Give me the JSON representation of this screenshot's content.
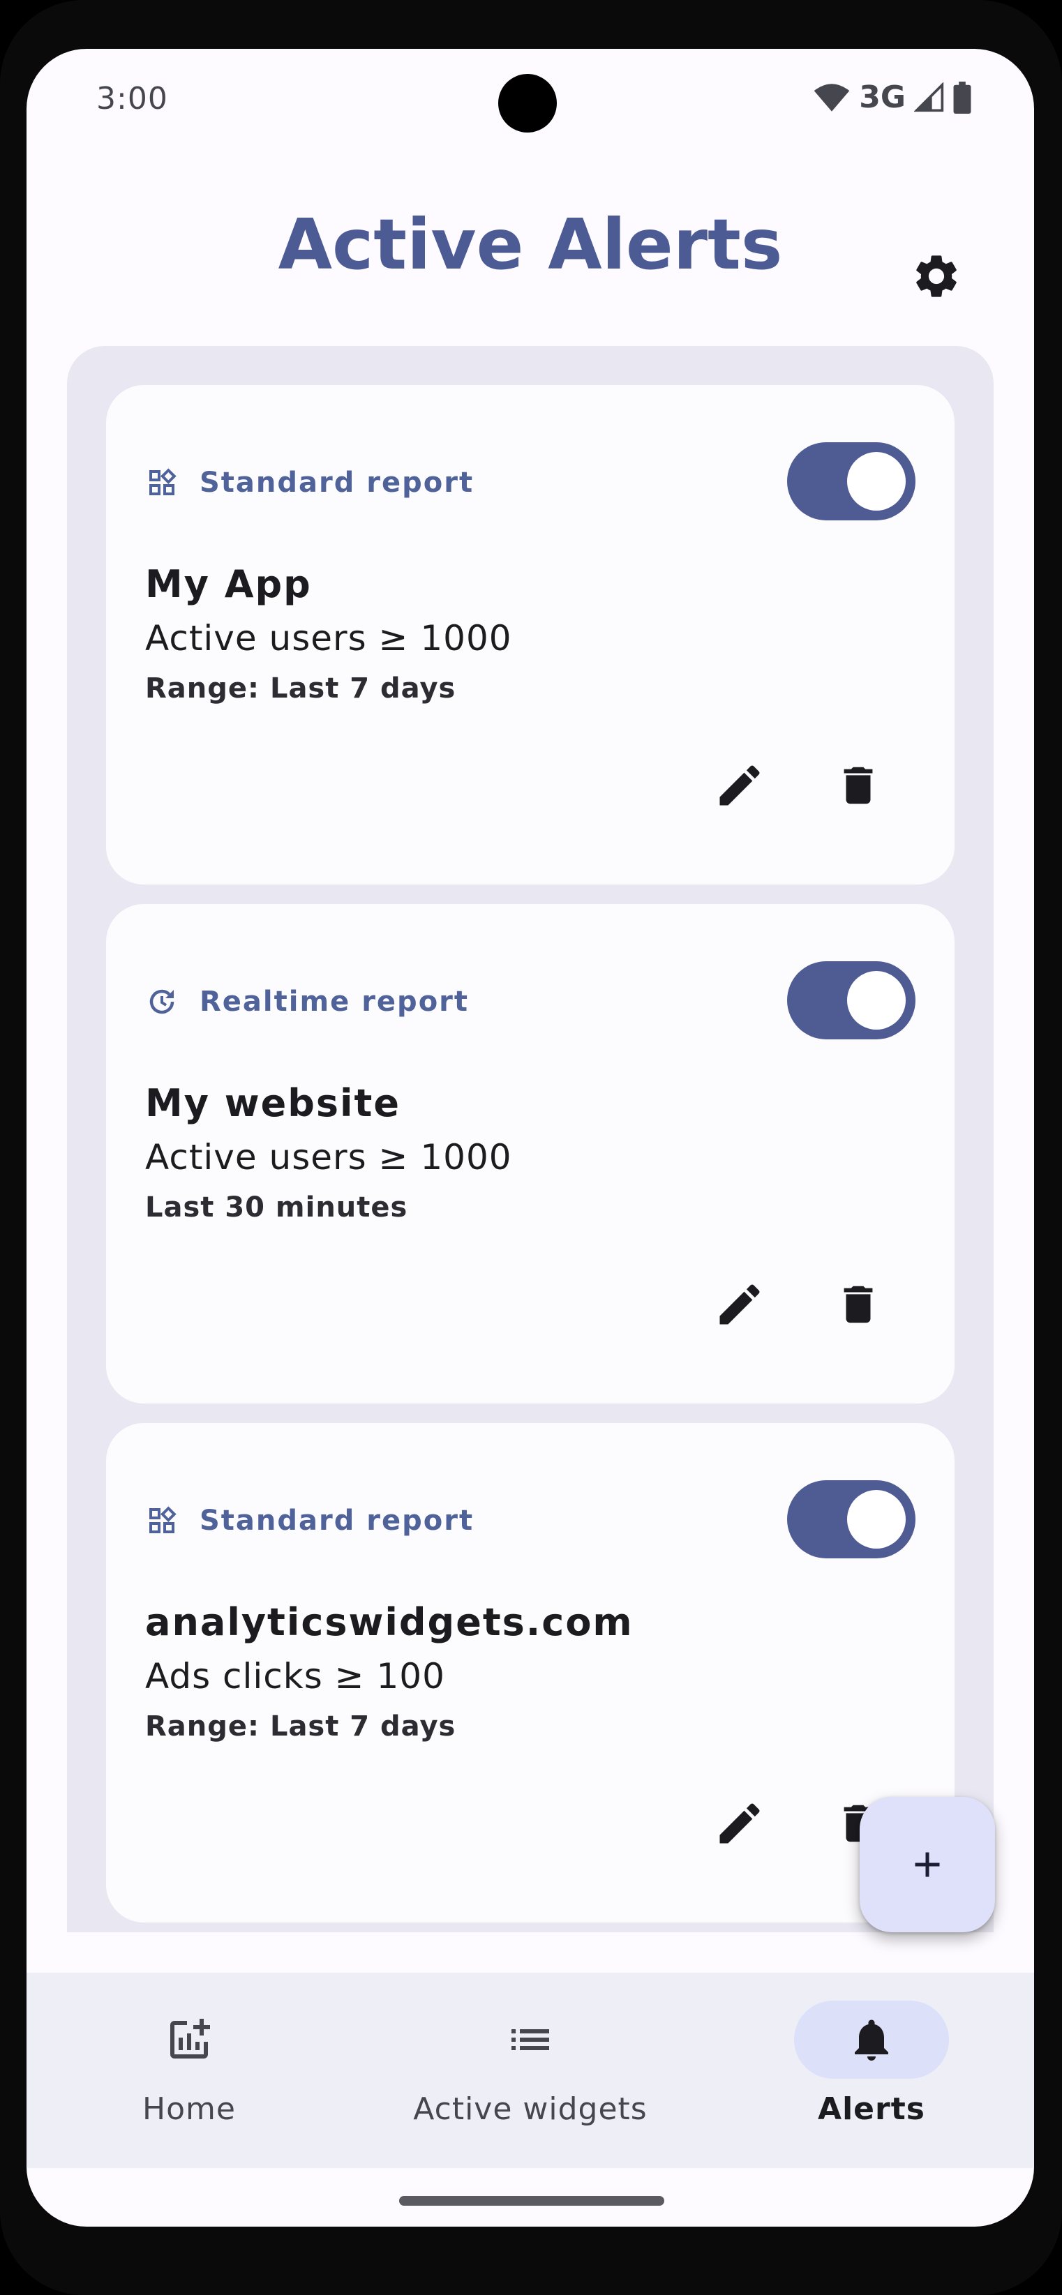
{
  "status_bar": {
    "time": "3:00",
    "network": "3G"
  },
  "header": {
    "title": "Active Alerts"
  },
  "alerts": [
    {
      "type_icon": "widgets-icon",
      "type": "Standard report",
      "enabled": true,
      "name": "My App",
      "condition": "Active users ≥ 1000",
      "range": "Range: Last 7 days"
    },
    {
      "type_icon": "realtime-icon",
      "type": "Realtime report",
      "enabled": true,
      "name": "My website",
      "condition": "Active users ≥ 1000",
      "range": "Last 30 minutes"
    },
    {
      "type_icon": "widgets-icon",
      "type": "Standard report",
      "enabled": true,
      "name": "analyticswidgets.com",
      "condition": "Ads clicks ≥ 100",
      "range": "Range: Last 7 days"
    }
  ],
  "fab": {
    "icon": "add-icon"
  },
  "bottom_nav": {
    "items": [
      {
        "label": "Home",
        "icon": "chart-add-icon",
        "active": false
      },
      {
        "label": "Active widgets",
        "icon": "list-icon",
        "active": false
      },
      {
        "label": "Alerts",
        "icon": "bell-icon",
        "active": true
      }
    ]
  },
  "colors": {
    "primary": "#4c5b94",
    "toggle_on": "#4f5c93",
    "list_background": "#e9e8f2",
    "card_background": "#fcfbfe",
    "fab_background": "#dfe1fb",
    "nav_background": "#eeeef7",
    "nav_active_pill": "#dce0f8"
  }
}
